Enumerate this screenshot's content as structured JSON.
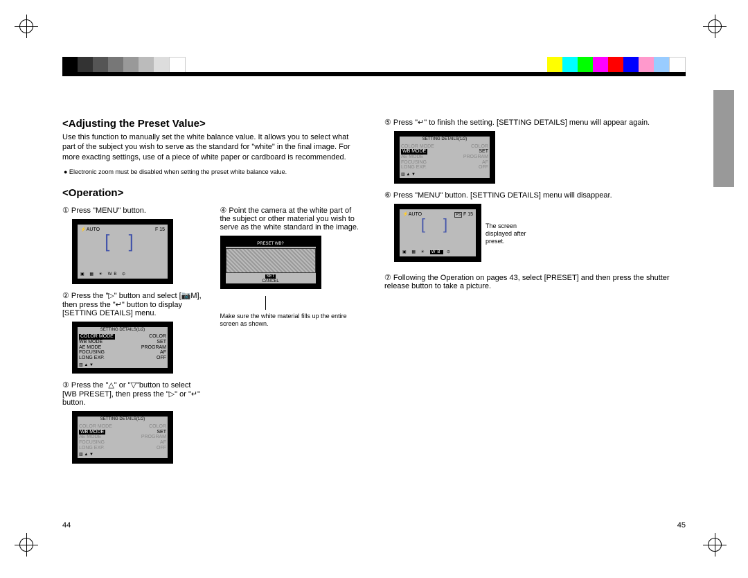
{
  "section1_title": "<Adjusting the Preset Value>",
  "intro": "Use this function to manually set the white balance value. It allows you to select what part of the subject you wish to serve as the standard for \"white\" in the final image. For more exacting settings, use of a piece of white paper or cardboard is recommended.",
  "note_bullet": "● Electronic zoom must be disabled when setting the preset white balance value.",
  "section2_title": "<Operation>",
  "step1": "① Press \"MENU\" button.",
  "step2": "② Press the \"▷\" button and select [📷M], then press the \"↵\" button to display [SETTING DETAILS] menu.",
  "step3": "③ Press the \"△\" or \"▽\"button to select [WB PRESET], then press the \"▷\" or \"↵\" button.",
  "step4": "④ Point the camera at the white part of the subject or other material you wish to serve as the white standard in the image.",
  "step4_note": "Make sure the white material fills up the entire screen as shown.",
  "step5": "⑤ Press \"↵\" to finish the setting. [SETTING DETAILS] menu will appear again.",
  "step6": "⑥ Press \"MENU\" button. [SETTING DETAILS] menu will disappear.",
  "step6_sidenote": "The screen displayed after preset.",
  "step7": "⑦ Following the Operation on pages 43, select [PRESET] and then press the shutter release button to take a picture.",
  "page_left": "44",
  "page_right": "45",
  "lcd_auto_top": "⚡AUTO",
  "lcd_f": "F 15",
  "lcd_menu_title": "SETTING DETAILS(1/2)",
  "lcd_rows": {
    "color_mode": "COLOR MODE",
    "color_val": "COLOR",
    "wb_mode": "WB MODE",
    "wb_val": "SET",
    "ae_mode": "AE MODE",
    "ae_val": "PROGRAM",
    "focusing": "FOCUSING",
    "focus_val": "AF",
    "long_exp": "LONG EXP.",
    "long_val": "OFF"
  },
  "lcd_preset_title": "PRESET WB?",
  "lcd_set": "SET",
  "lcd_cancel": "CANCEL",
  "lcd_brackets": "[ ]",
  "color_bar_grays": [
    "#000",
    "#333",
    "#555",
    "#777",
    "#999",
    "#bbb",
    "#ddd",
    "#fff"
  ],
  "color_bar_colors": [
    "#ff0",
    "#0ff",
    "#0f0",
    "#f0f",
    "#f00",
    "#00f",
    "#f99",
    "#9ff",
    "#fff"
  ]
}
